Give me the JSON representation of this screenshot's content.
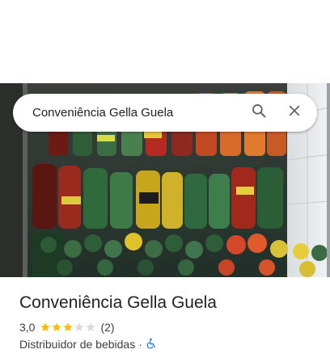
{
  "search": {
    "query": "Conveniência Gella Guela",
    "search_icon": "search-icon",
    "close_icon": "close-icon"
  },
  "place": {
    "name": "Conveniência Gella Guela",
    "rating": "3,0",
    "stars_filled": 3,
    "stars_total": 5,
    "review_count": "(2)",
    "category": "Distribuidor de bebidas",
    "separator": "·",
    "accessibility_icon": "wheelchair-icon"
  },
  "colors": {
    "star_filled": "#fbbc04",
    "star_empty": "#dadce0",
    "accessibility": "#1a73e8",
    "text_primary": "#202124",
    "text_secondary": "#3c4043"
  }
}
